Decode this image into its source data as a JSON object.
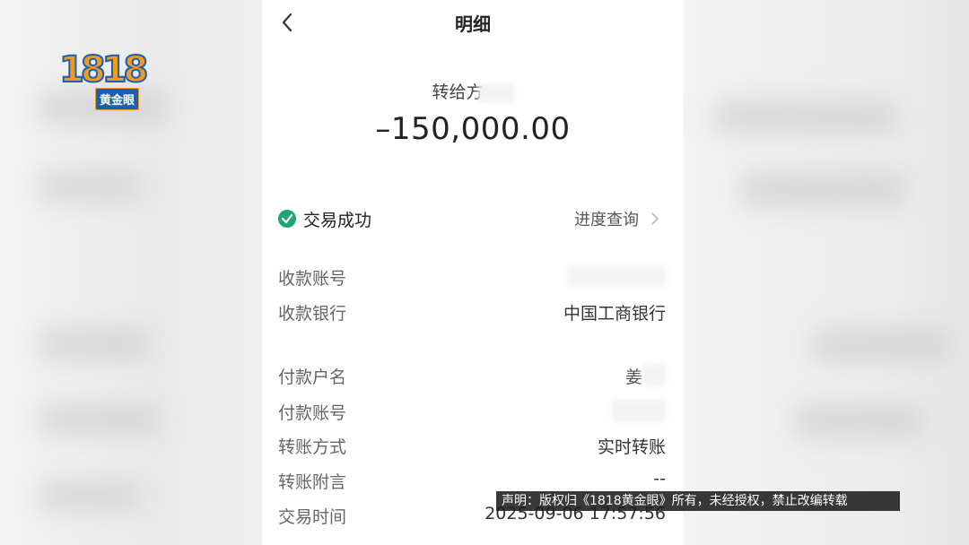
{
  "logo": {
    "number": "1818",
    "brand": "黄金眼"
  },
  "header": {
    "back_icon": "chevron-left-icon",
    "title": "明细"
  },
  "transaction": {
    "payee_label": "转给方",
    "amount": "–150,000.00",
    "status_icon": "check-circle-icon",
    "status": "交易成功",
    "progress_link": "进度查询",
    "status_color": "#1ea672"
  },
  "details": {
    "rows": [
      {
        "label": "收款账号",
        "value": ""
      },
      {
        "label": "收款银行",
        "value": "中国工商银行"
      },
      {
        "label": "付款户名",
        "value": "姜"
      },
      {
        "label": "付款账号",
        "value": ""
      },
      {
        "label": "转账方式",
        "value": "实时转账"
      },
      {
        "label": "转账附言",
        "value": "--"
      },
      {
        "label": "交易时间",
        "value": "2025-09-06 17:57:56"
      }
    ]
  },
  "watermark": {
    "disclaimer": "声明：版权归《1818黄金眼》所有，未经授权，禁止改编转载"
  }
}
